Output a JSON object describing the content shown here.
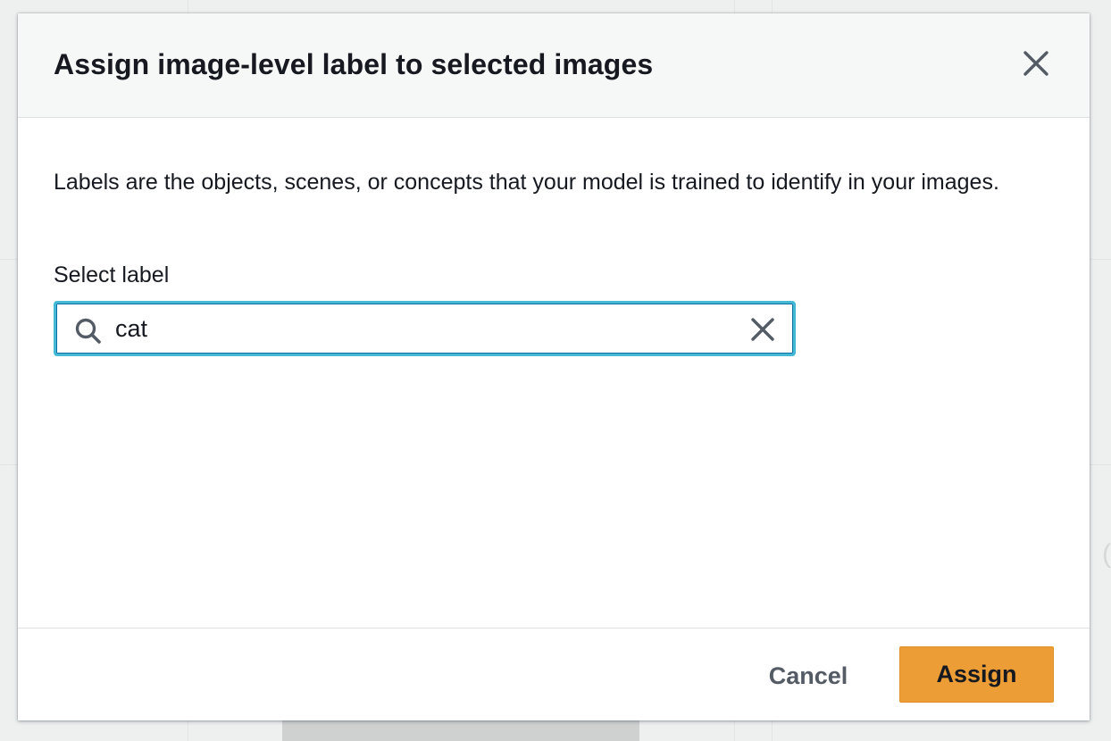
{
  "modal": {
    "title": "Assign image-level label to selected images",
    "close_icon": "close-icon",
    "description": "Labels are the objects, scenes, or concepts that your model is trained to identify in your images."
  },
  "label_select": {
    "label": "Select label",
    "value": "cat",
    "search_icon": "search-icon",
    "clear_icon": "clear-icon"
  },
  "footer": {
    "cancel_label": "Cancel",
    "assign_label": "Assign"
  },
  "colors": {
    "primary_button": "#ec9d35",
    "focus_ring": "#44b9d6",
    "text": "#16191f",
    "secondary_text": "#545b64",
    "header_bg": "#f6f7f7"
  }
}
